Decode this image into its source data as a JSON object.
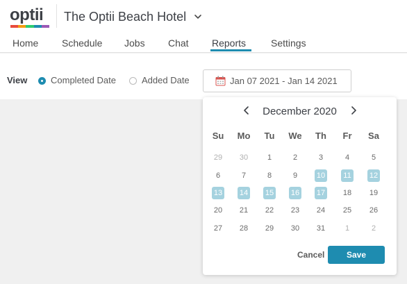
{
  "brand": {
    "logo_text": "optii",
    "logo_colors": [
      "#e84b3c",
      "#f39c12",
      "#2ecc71",
      "#1e8cb0",
      "#9b59b6"
    ]
  },
  "header": {
    "hotel_name": "The Optii Beach Hotel",
    "hotel_chevron_icon": "chevron-down-icon"
  },
  "nav": {
    "items": [
      {
        "label": "Home"
      },
      {
        "label": "Schedule"
      },
      {
        "label": "Jobs"
      },
      {
        "label": "Chat"
      },
      {
        "label": "Reports",
        "active": true
      },
      {
        "label": "Settings"
      }
    ]
  },
  "filters": {
    "view_label": "View",
    "options": [
      {
        "label": "Completed Date",
        "checked": true
      },
      {
        "label": "Added Date",
        "checked": false
      }
    ],
    "date_range": "Jan 07 2021 - Jan 14 2021",
    "calendar_icon": "calendar-icon"
  },
  "datepicker": {
    "month_title": "December 2020",
    "weekdays": [
      "Su",
      "Mo",
      "Tu",
      "We",
      "Th",
      "Fr",
      "Sa"
    ],
    "weeks": [
      [
        {
          "d": "29",
          "m": 1
        },
        {
          "d": "30",
          "m": 1
        },
        {
          "d": "1"
        },
        {
          "d": "2"
        },
        {
          "d": "3"
        },
        {
          "d": "4"
        },
        {
          "d": "5"
        }
      ],
      [
        {
          "d": "6"
        },
        {
          "d": "7"
        },
        {
          "d": "8"
        },
        {
          "d": "9"
        },
        {
          "d": "10",
          "s": 1
        },
        {
          "d": "11",
          "s": 1
        },
        {
          "d": "12",
          "s": 1
        }
      ],
      [
        {
          "d": "13",
          "s": 1
        },
        {
          "d": "14",
          "s": 1
        },
        {
          "d": "15",
          "s": 1
        },
        {
          "d": "16",
          "s": 1
        },
        {
          "d": "17",
          "s": 1
        },
        {
          "d": "18"
        },
        {
          "d": "19"
        }
      ],
      [
        {
          "d": "20"
        },
        {
          "d": "21"
        },
        {
          "d": "22"
        },
        {
          "d": "23"
        },
        {
          "d": "24"
        },
        {
          "d": "25"
        },
        {
          "d": "26"
        }
      ],
      [
        {
          "d": "27"
        },
        {
          "d": "28"
        },
        {
          "d": "29"
        },
        {
          "d": "30"
        },
        {
          "d": "31"
        },
        {
          "d": "1",
          "m": 1
        },
        {
          "d": "2",
          "m": 1
        }
      ]
    ],
    "cancel_label": "Cancel",
    "save_label": "Save",
    "accent_color": "#1e8cb0",
    "selected_color": "#a5d2df"
  }
}
